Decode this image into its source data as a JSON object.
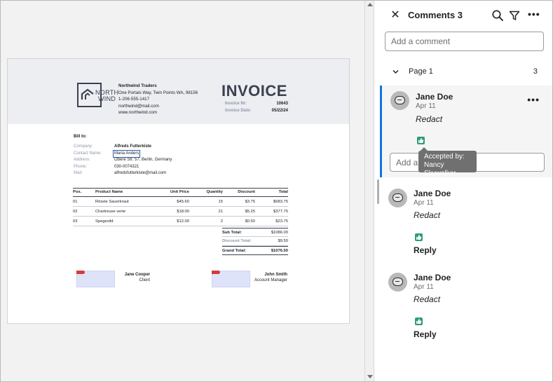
{
  "invoice": {
    "company_name": "Northwind Traders",
    "address": "One Portals Way, Twin Points WA, 98156",
    "phone": "1-206-555-1417",
    "email": "northwind@mail.com",
    "website": "www.northwind.com",
    "logo_line1": "NORTH",
    "logo_line2": "WIND",
    "title": "INVOICE",
    "number_label": "Invoice Nr:",
    "number": "10643",
    "date_label": "Invoice Date:",
    "date": "05/22/24",
    "bill_to_label": "Bill to:",
    "bill_to": [
      {
        "label": "Company:",
        "value": "Alfreds Futterkiste"
      },
      {
        "label": "Contact Name:",
        "value": "Maria Anders"
      },
      {
        "label": "Address:",
        "value": "Obere Str. 57, Berlin, Germany"
      },
      {
        "label": "Phone:",
        "value": "030-0074321"
      },
      {
        "label": "Mail:",
        "value": "alfredsfutterkiste@mail.com"
      }
    ],
    "columns": [
      "Pos.",
      "Product Name",
      "Unit Price",
      "Quantity",
      "Discount",
      "Total"
    ],
    "rows": [
      [
        "01",
        "Rössle Sauerkraut",
        "$45.60",
        "15",
        "$3.75",
        "$683.75"
      ],
      [
        "02",
        "Chartreuse verte",
        "$18.00",
        "21",
        "$5.25",
        "$377.75"
      ],
      [
        "03",
        "Spegesild",
        "$12.00",
        "2",
        "$0.50",
        "$23.75"
      ]
    ],
    "subtotal_label": "Sub Total:",
    "subtotal": "$1086.00",
    "discount_label": "Discount Total:",
    "discount": "$9.50",
    "grand_label": "Grand Total:",
    "grand": "$1076.50",
    "signatures": [
      {
        "name": "Jane Cooper",
        "role": "Client"
      },
      {
        "name": "John Smith",
        "role": "Account Manager"
      }
    ]
  },
  "panel": {
    "title": "Comments 3",
    "add_comment_placeholder": "Add a comment",
    "page_group_label": "Page 1",
    "page_group_count": "3",
    "reply_placeholder": "Add a reply",
    "reply_label": "Reply",
    "more_label": "•••",
    "comments": [
      {
        "author": "Jane Doe",
        "date": "Apr 11",
        "text": "Redact"
      },
      {
        "author": "Jane Doe",
        "date": "Apr 11",
        "text": "Redact"
      },
      {
        "author": "Jane Doe",
        "date": "Apr 11",
        "text": "Redact"
      }
    ],
    "tooltip_line1": "Accepted by:",
    "tooltip_line2": "Nancy Skywalker"
  },
  "colors": {
    "accent": "#1473e6",
    "accepted": "#2d9d78",
    "invoice_dark": "#3c4150"
  }
}
